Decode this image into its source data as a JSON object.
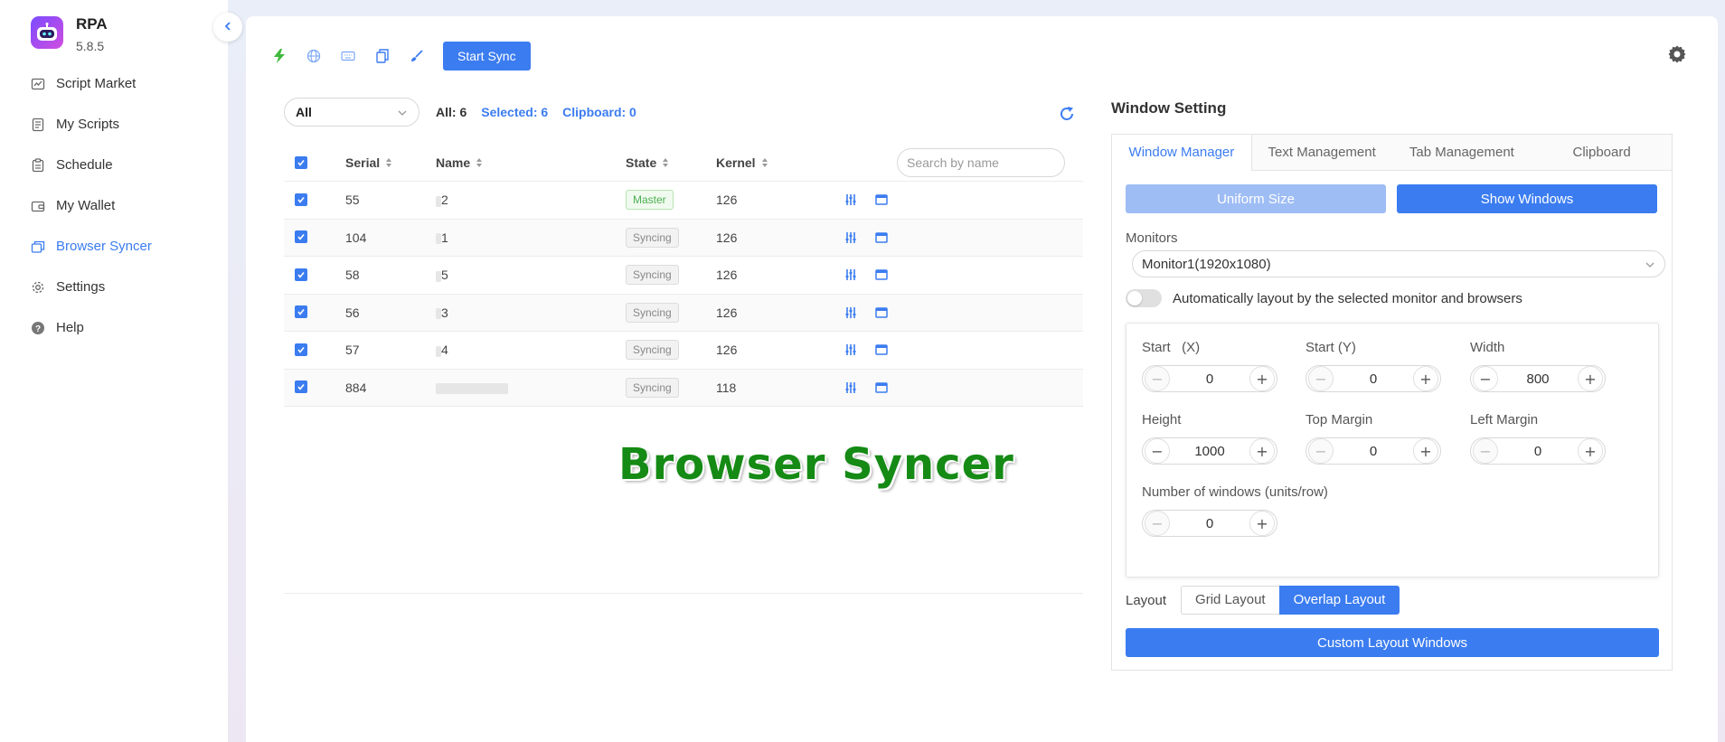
{
  "app": {
    "name": "RPA",
    "version": "5.8.5"
  },
  "sidebar": {
    "items": [
      {
        "label": "Script Market",
        "icon": "chart-icon"
      },
      {
        "label": "My Scripts",
        "icon": "script-icon"
      },
      {
        "label": "Schedule",
        "icon": "clipboard-icon"
      },
      {
        "label": "My Wallet",
        "icon": "wallet-icon"
      },
      {
        "label": "Browser Syncer",
        "icon": "windows-icon",
        "active": true
      },
      {
        "label": "Settings",
        "icon": "gear-icon"
      },
      {
        "label": "Help",
        "icon": "help-icon"
      }
    ]
  },
  "toolbar": {
    "start_sync_label": "Start Sync"
  },
  "filters": {
    "group_select": "All",
    "all_count": "All: 6",
    "selected_count": "Selected: 6",
    "clipboard_count": "Clipboard: 0"
  },
  "table": {
    "columns": {
      "serial": "Serial",
      "name": "Name",
      "state": "State",
      "kernel": "Kernel"
    },
    "search_placeholder": "Search by name",
    "rows": [
      {
        "serial": "55",
        "name": "2",
        "state": "Master",
        "kernel": "126"
      },
      {
        "serial": "104",
        "name": "1",
        "state": "Syncing",
        "kernel": "126"
      },
      {
        "serial": "58",
        "name": "5",
        "state": "Syncing",
        "kernel": "126"
      },
      {
        "serial": "56",
        "name": "3",
        "state": "Syncing",
        "kernel": "126"
      },
      {
        "serial": "57",
        "name": "4",
        "state": "Syncing",
        "kernel": "126"
      },
      {
        "serial": "884",
        "name": "",
        "state": "Syncing",
        "kernel": "118"
      }
    ]
  },
  "watermark": "Browser Syncer",
  "window_setting": {
    "title": "Window Setting",
    "tabs": [
      "Window Manager",
      "Text Management",
      "Tab Management",
      "Clipboard"
    ],
    "uniform_size_label": "Uniform Size",
    "show_windows_label": "Show Windows",
    "monitors_label": "Monitors",
    "monitor_value": "Monitor1(1920x1080)",
    "auto_layout_label": "Automatically layout by the selected monitor and browsers",
    "fields": {
      "start_x": {
        "label": "Start   (X)",
        "value": "0"
      },
      "start_y": {
        "label": "Start (Y)",
        "value": "0"
      },
      "width": {
        "label": "Width",
        "value": "800"
      },
      "height": {
        "label": "Height",
        "value": "1000"
      },
      "top_margin": {
        "label": "Top Margin",
        "value": "0"
      },
      "left_margin": {
        "label": "Left Margin",
        "value": "0"
      },
      "windows_per_row": {
        "label": "Number of windows (units/row)",
        "value": "0"
      }
    },
    "layout_label": "Layout",
    "grid_layout_label": "Grid Layout",
    "overlap_layout_label": "Overlap Layout",
    "custom_layout_label": "Custom Layout Windows"
  },
  "colors": {
    "accent": "#3b7cf0",
    "master_tag": "#4caf50",
    "watermark": "#158a15"
  }
}
